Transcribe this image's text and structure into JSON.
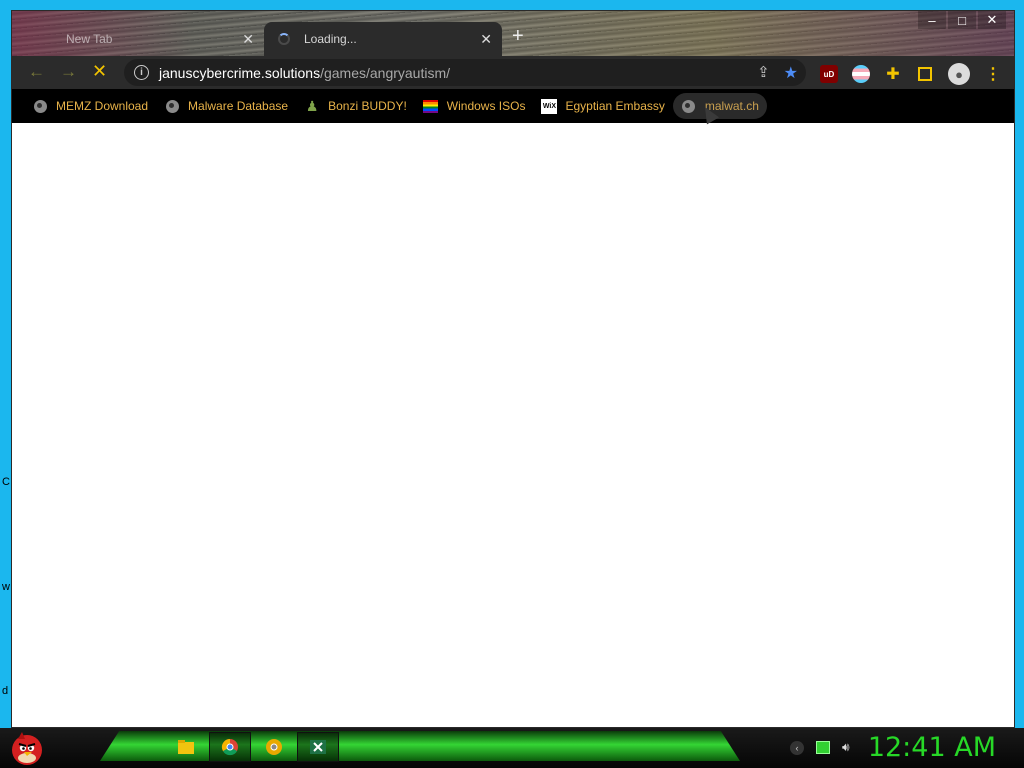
{
  "desktop": {
    "side_letters": [
      "C",
      "w",
      "d"
    ]
  },
  "browser": {
    "tabs": [
      {
        "title": "New Tab",
        "state": "inactive"
      },
      {
        "title": "Loading...",
        "state": "active-loading"
      }
    ],
    "new_tab_symbol": "+",
    "window_controls": {
      "minimize": "–",
      "maximize": "□",
      "close": "✕"
    },
    "nav": {
      "back": "←",
      "forward": "→",
      "stop": "✕"
    },
    "address": {
      "host": "januscybercrime.solutions",
      "path": "/games/angryautism/"
    },
    "bookmarks": [
      {
        "label": "MEMZ Download",
        "icon": "globe-icon"
      },
      {
        "label": "Malware Database",
        "icon": "globe-icon"
      },
      {
        "label": "Bonzi BUDDY!",
        "icon": "bonzi-icon"
      },
      {
        "label": "Windows ISOs",
        "icon": "rainbow-flag-icon"
      },
      {
        "label": "Egyptian Embassy",
        "icon": "wix-icon"
      },
      {
        "label": "malwat.ch",
        "icon": "globe-icon"
      }
    ],
    "extensions": {
      "ublock_label": "uD"
    },
    "accent_color": "#f3c400"
  },
  "taskbar": {
    "apps": [
      "file-explorer-icon",
      "chrome-icon",
      "chrome-canary-icon",
      "excel-icon"
    ],
    "clock": "12:41 AM"
  }
}
